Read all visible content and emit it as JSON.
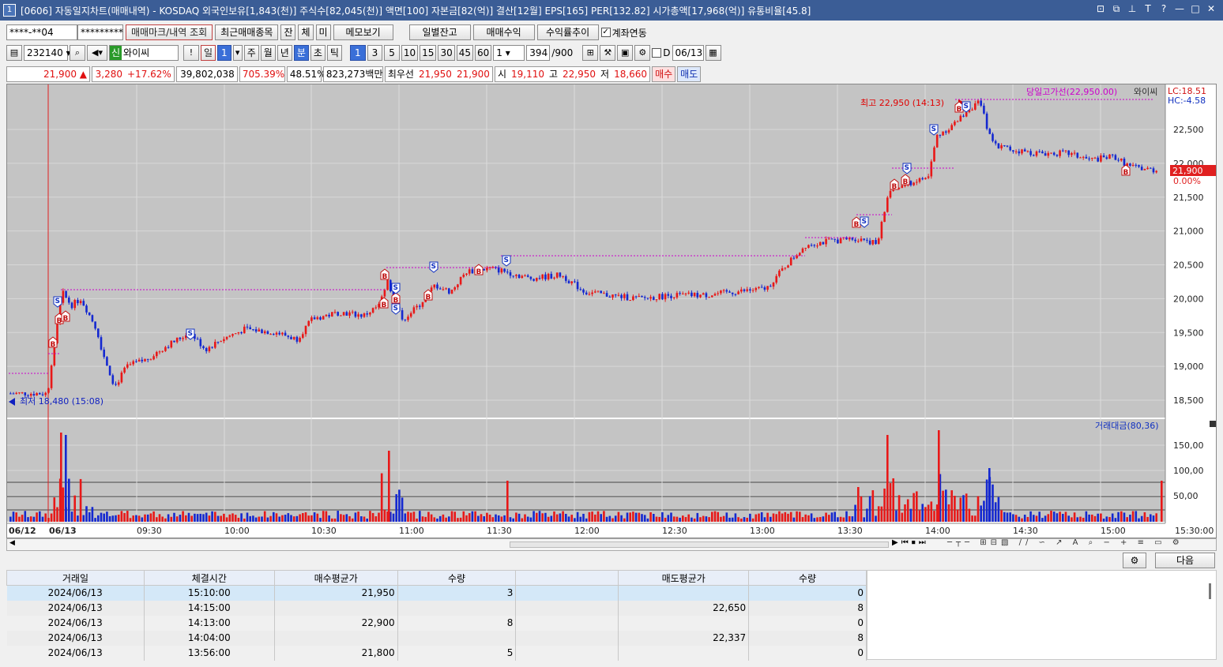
{
  "window": {
    "title": "[0606] 자동일지차트(매매내역) - KOSDAQ 외국인보유[1,843(천)] 주식수[82,045(천)] 액면[100] 자본금[82(억)] 결산[12월] EPS[165] PER[132.82] 시가총액[17,968(억)] 유통비율[45.8]",
    "icon": "1"
  },
  "toolbar1": {
    "account": "****-**04",
    "password": "*********",
    "btn_markers": "매매마크/내역 조회",
    "btn_recent": "최근매매종목",
    "btn_jan": "잔",
    "btn_che": "체",
    "btn_mi": "미",
    "btn_memo": "메모보기",
    "btn_daily": "일별잔고",
    "btn_profit": "매매수익",
    "btn_return": "수익률추이",
    "chk_link": "계좌연동"
  },
  "toolbar2": {
    "code": "232140",
    "stock_name": "와이씨",
    "sin": "신",
    "periods": [
      "일",
      "1",
      "주",
      "월",
      "년",
      "분",
      "초",
      "틱"
    ],
    "minutes": [
      "1",
      "3",
      "5",
      "10",
      "15",
      "30",
      "45",
      "60"
    ],
    "unit": "1",
    "count": "394",
    "count_max": "/900",
    "date": "06/13",
    "d_label": "D"
  },
  "quote": {
    "price": "21,900 ▲",
    "change": "3,280",
    "rate": "+17.62%",
    "volume": "39,802,038",
    "vol_rate": "705.39%",
    "ratio": "48.51%",
    "amount": "823,273백만",
    "best_label": "최우선",
    "ask": "21,950",
    "bid": "21,900",
    "open_label": "시",
    "open": "19,110",
    "high_label": "고",
    "high": "22,950",
    "low_label": "저",
    "low": "18,660",
    "buy": "매수",
    "sell": "매도"
  },
  "chart": {
    "high_marker": "최고 22,950 (14:13)",
    "low_marker": "최저 18,480 (15:08)",
    "high_line": "당일고가선(22,950.00)",
    "legend_name": "와이씨",
    "lc": "LC:18.51",
    "hc": "HC:-4.58",
    "price_tag": "21,900",
    "price_tag_rate": "0.00%",
    "vol_legend": "거래대금(80,36)",
    "y_labels": [
      "22,500",
      "22,000",
      "21,500",
      "21,000",
      "20,500",
      "20,000",
      "19,500",
      "19,000",
      "18,500"
    ],
    "vol_labels": [
      "150,00",
      "100,00",
      "50,00"
    ],
    "x_labels": [
      "06/12",
      "06/13",
      "09:30",
      "10:00",
      "10:30",
      "11:00",
      "11:30",
      "12:00",
      "12:30",
      "13:00",
      "13:30",
      "14:00",
      "14:30",
      "15:00",
      "15:30:00"
    ],
    "colors": {
      "up": "#e81818",
      "down": "#1428d0",
      "marker": "#cc00cc"
    }
  },
  "buttons": {
    "next": "다음"
  },
  "table": {
    "headers": [
      "거래일",
      "체결시간",
      "매수평균가",
      "수량",
      "",
      "매도평균가",
      "수량"
    ],
    "rows": [
      [
        "2024/06/13",
        "15:10:00",
        "21,950",
        "3",
        "",
        "",
        "0"
      ],
      [
        "2024/06/13",
        "14:15:00",
        "",
        "",
        "",
        "22,650",
        "8"
      ],
      [
        "2024/06/13",
        "14:13:00",
        "22,900",
        "8",
        "",
        "",
        "0"
      ],
      [
        "2024/06/13",
        "14:04:00",
        "",
        "",
        "",
        "22,337",
        "8"
      ],
      [
        "2024/06/13",
        "13:56:00",
        "21,800",
        "5",
        "",
        "",
        "0"
      ]
    ]
  }
}
